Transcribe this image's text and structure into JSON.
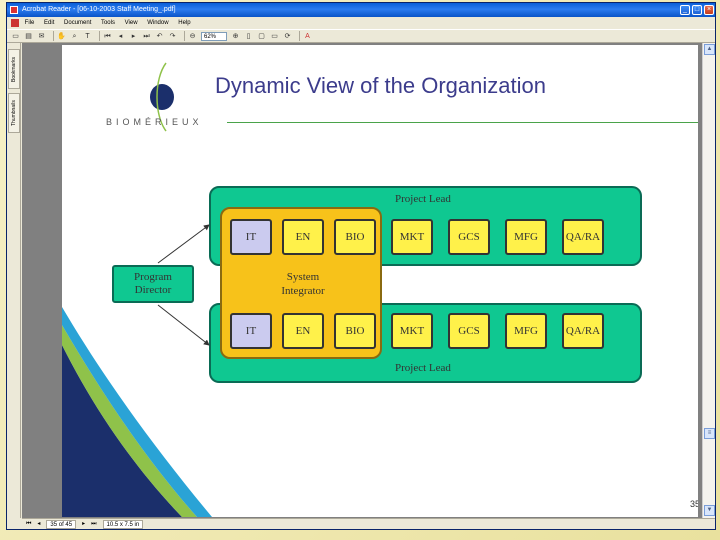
{
  "window": {
    "title": "Acrobat Reader - [06-10-2003 Staff Meeting_.pdf]",
    "minimize_label": "_",
    "maximize_label": "□",
    "close_label": "×"
  },
  "menu": {
    "items": [
      "File",
      "Edit",
      "Document",
      "Tools",
      "View",
      "Window",
      "Help"
    ]
  },
  "toolbar": {
    "zoom_value": "62%"
  },
  "side_tabs": {
    "bookmarks": "Bookmarks",
    "thumbnails": "Thumbnails"
  },
  "status": {
    "page_indicator": "35 of 45",
    "page_size": "10.5 x 7.5 in"
  },
  "slide": {
    "title": "Dynamic View of the Organization",
    "logo": "BIOMÉRIEUX",
    "page_number": "35",
    "top_lane_label": "Project Lead",
    "bottom_lane_label": "Project Lead",
    "program_director": [
      "Program",
      "Director"
    ],
    "system_integrator": [
      "System",
      "Integrator"
    ],
    "top_boxes": [
      "IT",
      "EN",
      "BIO",
      "MKT",
      "GCS",
      "MFG",
      "QA/RA"
    ],
    "bottom_boxes": [
      "IT",
      "EN",
      "BIO",
      "MKT",
      "GCS",
      "MFG",
      "QA/RA"
    ]
  },
  "colors": {
    "lane_green": "#0fc891",
    "integrator_yellow": "#f7c21a",
    "function_box_yellow": "#fff14a",
    "it_box_lavender": "#cbcbef",
    "title_blue": "#3c3c8c",
    "swoosh_navy": "#1b2f6b"
  }
}
